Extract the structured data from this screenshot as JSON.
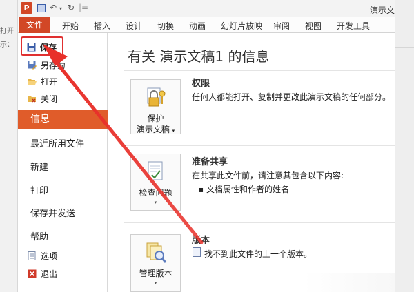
{
  "background_window": {
    "left_text_1": "打开",
    "left_text_2": "示："
  },
  "titlebar": {
    "app_icon_letter": "P",
    "window_title": "演示文"
  },
  "ribbon": {
    "tabs": [
      "文件",
      "开始",
      "插入",
      "设计",
      "切换",
      "动画",
      "幻灯片放映",
      "审阅",
      "视图",
      "开发工具"
    ]
  },
  "nav": {
    "save": "保存",
    "save_as": "另存为",
    "open": "打开",
    "close": "关闭",
    "info": "信息",
    "recent": "最近所用文件",
    "new": "新建",
    "print": "打印",
    "save_send": "保存并发送",
    "help": "帮助",
    "options": "选项",
    "exit": "退出"
  },
  "main": {
    "title": "有关 演示文稿1 的信息",
    "permissions": {
      "button_line1": "保护",
      "button_line2": "演示文稿",
      "title": "权限",
      "desc": "任何人都能打开、复制并更改此演示文稿的任何部分。"
    },
    "prepare": {
      "button_label": "检查问题",
      "title": "准备共享",
      "desc": "在共享此文件前，请注意其包含以下内容:",
      "bullet": "文档属性和作者的姓名"
    },
    "versions": {
      "button_label": "管理版本",
      "title": "版本",
      "desc": "找不到此文件的上一个版本。"
    }
  },
  "colors": {
    "accent": "#d24726",
    "nav_selected": "#e05c2a",
    "annotation": "#e03030"
  }
}
